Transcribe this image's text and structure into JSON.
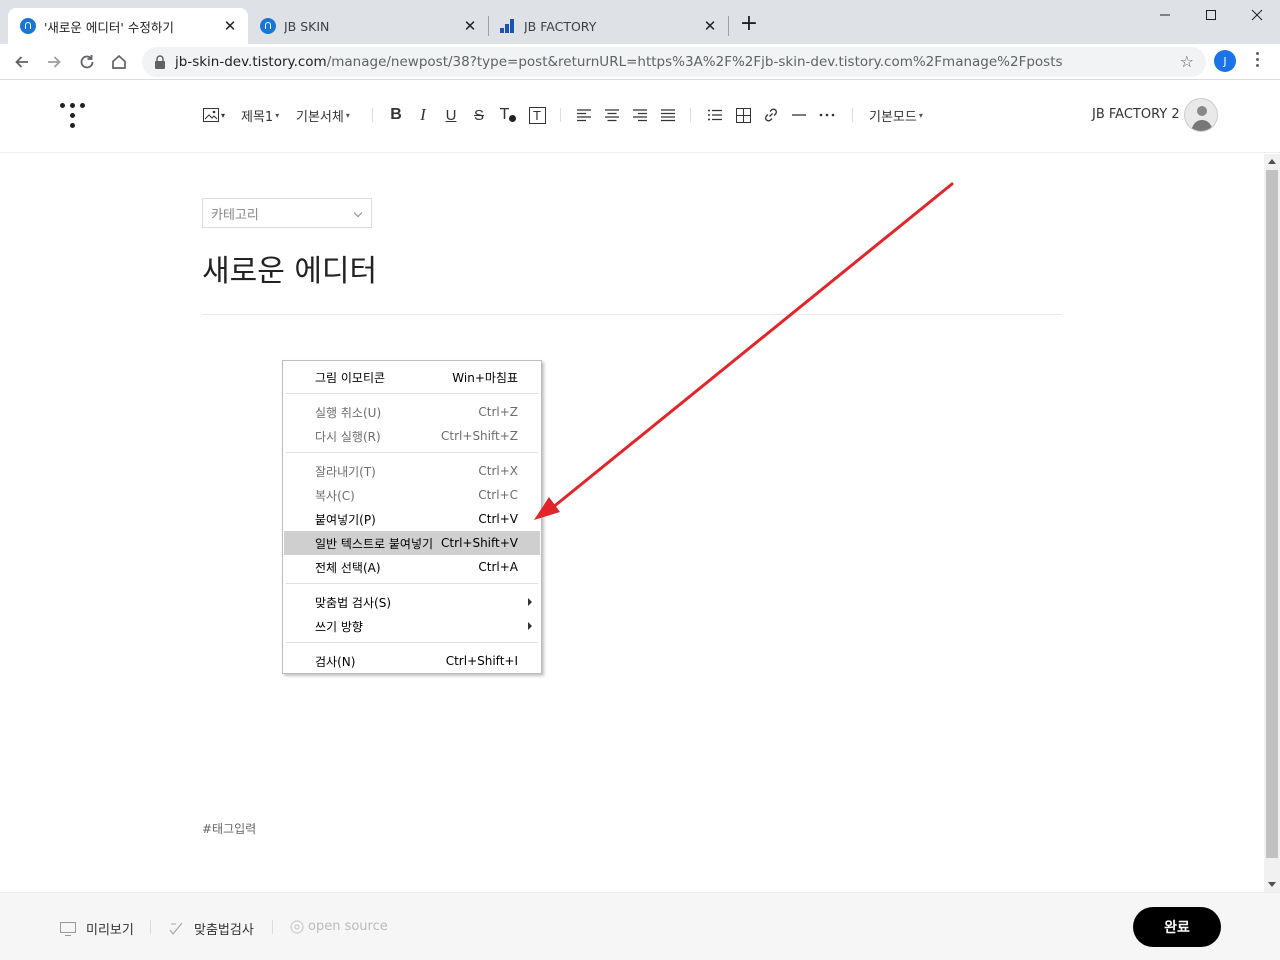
{
  "browser": {
    "tabs": [
      {
        "title": "'새로운 에디터' 수정하기",
        "icon": "tistory-favicon-icon",
        "active": true
      },
      {
        "title": "JB SKIN",
        "icon": "tistory-favicon-icon",
        "active": false
      },
      {
        "title": "JB FACTORY",
        "icon": "bar-chart-favicon-icon",
        "active": false
      }
    ],
    "url_host": "jb-skin-dev.tistory.com",
    "url_path": "/manage/newpost/38?type=post&returnURL=https%3A%2F%2Fjb-skin-dev.tistory.com%2Fmanage%2Fposts",
    "profile_initial": "J",
    "accent": "#1a73e8"
  },
  "editor_toolbar": {
    "heading": "제목1",
    "font": "기본서체",
    "bold": "B",
    "italic": "I",
    "underline": "U",
    "strike": "S",
    "text_color": "T",
    "text_bg": "T",
    "mode": "기본모드",
    "blog_name": "JB FACTORY 2"
  },
  "post": {
    "category_placeholder": "카테고리",
    "title": "새로운 에디터",
    "tag_placeholder": "#태그입력"
  },
  "context_menu": {
    "groups": [
      [
        {
          "label": "그림 이모티콘",
          "shortcut": "Win+마침표",
          "state": "enabled"
        }
      ],
      [
        {
          "label": "실행 취소(U)",
          "shortcut": "Ctrl+Z",
          "state": "disabled"
        },
        {
          "label": "다시 실행(R)",
          "shortcut": "Ctrl+Shift+Z",
          "state": "disabled"
        }
      ],
      [
        {
          "label": "잘라내기(T)",
          "shortcut": "Ctrl+X",
          "state": "disabled"
        },
        {
          "label": "복사(C)",
          "shortcut": "Ctrl+C",
          "state": "disabled"
        },
        {
          "label": "붙여넣기(P)",
          "shortcut": "Ctrl+V",
          "state": "enabled"
        },
        {
          "label": "일반 텍스트로 붙여넣기",
          "shortcut": "Ctrl+Shift+V",
          "state": "highlighted"
        },
        {
          "label": "전체 선택(A)",
          "shortcut": "Ctrl+A",
          "state": "enabled"
        }
      ],
      [
        {
          "label": "맞춤법 검사(S)",
          "shortcut": "",
          "state": "enabled",
          "submenu": true
        },
        {
          "label": "쓰기 방향",
          "shortcut": "",
          "state": "enabled",
          "submenu": true
        }
      ],
      [
        {
          "label": "검사(N)",
          "shortcut": "Ctrl+Shift+I",
          "state": "enabled"
        }
      ]
    ]
  },
  "footer": {
    "preview": "미리보기",
    "spellcheck": "맞춤법검사",
    "open_source": "open source",
    "done": "완료"
  },
  "annotation_color": "#e0262b"
}
